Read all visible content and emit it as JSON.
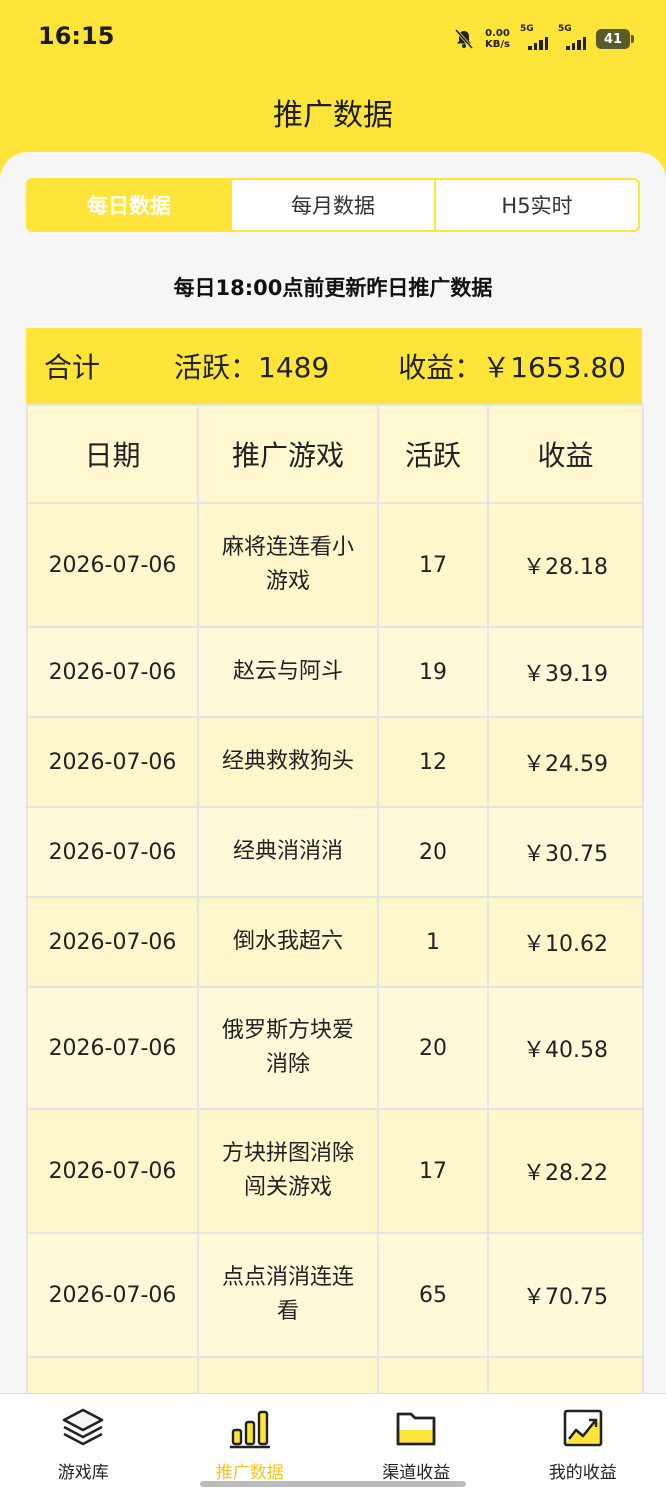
{
  "status_bar": {
    "time": "16:15",
    "speed_value": "0.00",
    "speed_unit": "KB/s",
    "signal1": "5G",
    "signal2": "5G",
    "battery": "41"
  },
  "header": {
    "title": "推广数据"
  },
  "tabs": [
    {
      "label": "每日数据",
      "active": true
    },
    {
      "label": "每月数据",
      "active": false
    },
    {
      "label": "H5实时",
      "active": false
    }
  ],
  "notice": "每日18:00点前更新昨日推广数据",
  "summary": {
    "label": "合计",
    "active": "活跃：1489",
    "revenue": "收益：￥1653.80"
  },
  "table": {
    "columns": [
      "日期",
      "推广游戏",
      "活跃",
      "收益"
    ],
    "rows": [
      {
        "date": "2026-07-06",
        "game": "麻将连连看小游戏",
        "active": "17",
        "revenue": "￥28.18"
      },
      {
        "date": "2026-07-06",
        "game": "赵云与阿斗",
        "active": "19",
        "revenue": "￥39.19"
      },
      {
        "date": "2026-07-06",
        "game": "经典救救狗头",
        "active": "12",
        "revenue": "￥24.59"
      },
      {
        "date": "2026-07-06",
        "game": "经典消消消",
        "active": "20",
        "revenue": "￥30.75"
      },
      {
        "date": "2026-07-06",
        "game": "倒水我超六",
        "active": "1",
        "revenue": "￥10.62"
      },
      {
        "date": "2026-07-06",
        "game": "俄罗斯方块爱消除",
        "active": "20",
        "revenue": "￥40.58"
      },
      {
        "date": "2026-07-06",
        "game": "方块拼图消除闯关游戏",
        "active": "17",
        "revenue": "￥28.22"
      },
      {
        "date": "2026-07-06",
        "game": "点点消消连连看",
        "active": "65",
        "revenue": "￥70.75"
      },
      {
        "date": "",
        "game": "",
        "active": "",
        "revenue": ""
      }
    ]
  },
  "tabbar": [
    {
      "label": "游戏库",
      "icon": "layers-icon",
      "active": false
    },
    {
      "label": "推广数据",
      "icon": "bar-chart-icon",
      "active": true
    },
    {
      "label": "渠道收益",
      "icon": "folder-icon",
      "active": false
    },
    {
      "label": "我的收益",
      "icon": "trend-chart-icon",
      "active": false
    }
  ],
  "colors": {
    "accent": "#FFE43A",
    "active_tab_text": "#F5C518",
    "row_bg": "#FFF7CC"
  }
}
